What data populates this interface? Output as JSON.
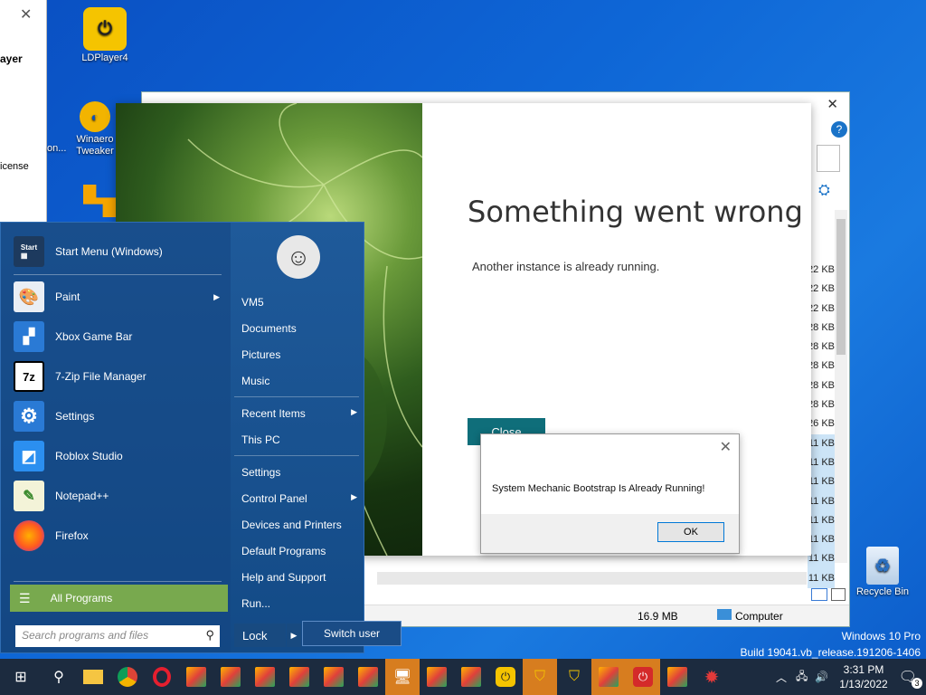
{
  "desktop": {
    "icons": [
      {
        "label": "LDPlayer4"
      },
      {
        "label": "Winaero Tweaker"
      }
    ],
    "left_panel_texts": [
      "ayer",
      "on...",
      "icense"
    ],
    "recycle_bin": "Recycle Bin",
    "watermark": {
      "line1": "Windows 10 Pro",
      "line2": "Build 19041.vb_release.191206-1406"
    }
  },
  "explorer": {
    "sizes": [
      "22 KB",
      "22 KB",
      "22 KB",
      "28 KB",
      "28 KB",
      "28 KB",
      "28 KB",
      "28 KB",
      "26 KB",
      "11 KB",
      "11 KB",
      "11 KB",
      "11 KB",
      "11 KB",
      "11 KB",
      "11 KB",
      "11 KB"
    ],
    "status_size": "16.9 MB",
    "status_location": "Computer"
  },
  "error_dialog": {
    "title": "Something went wrong",
    "message": "Another instance is already running.",
    "close_label": "Close"
  },
  "msgbox": {
    "text": "System Mechanic Bootstrap Is Already Running!",
    "ok_label": "OK"
  },
  "start_menu": {
    "programs": [
      {
        "label": "Start Menu (Windows)",
        "icon": "start-menu-icon",
        "has_arrow": false
      },
      {
        "label": "Paint",
        "icon": "paint-icon",
        "has_arrow": true
      },
      {
        "label": "Xbox Game Bar",
        "icon": "xbox-game-bar-icon",
        "has_arrow": false
      },
      {
        "label": "7-Zip File Manager",
        "icon": "7zip-icon",
        "has_arrow": false
      },
      {
        "label": "Settings",
        "icon": "gear-icon",
        "has_arrow": false
      },
      {
        "label": "Roblox Studio",
        "icon": "roblox-studio-icon",
        "has_arrow": false
      },
      {
        "label": "Notepad++",
        "icon": "notepadpp-icon",
        "has_arrow": false
      },
      {
        "label": "Firefox",
        "icon": "firefox-icon",
        "has_arrow": false
      }
    ],
    "all_programs": "All Programs",
    "search_placeholder": "Search programs and files",
    "right_items": {
      "user": "VM5",
      "documents": "Documents",
      "pictures": "Pictures",
      "music": "Music",
      "recent": "Recent Items",
      "thispc": "This PC",
      "settings": "Settings",
      "control_panel": "Control Panel",
      "devices": "Devices and Printers",
      "default_programs": "Default Programs",
      "help": "Help and Support",
      "run": "Run..."
    },
    "lock": "Lock",
    "switch_user": "Switch user"
  },
  "taskbar": {
    "time": "3:31 PM",
    "date": "1/13/2022",
    "notification_count": "3"
  },
  "colors": {
    "desktop": "#0e66d6",
    "start_menu": "#1f5a9a",
    "all_programs_bg": "#78a94e",
    "close_button": "#0f6e7a",
    "taskbar": "#1c2b3f",
    "running_app": "#d77d1f"
  }
}
